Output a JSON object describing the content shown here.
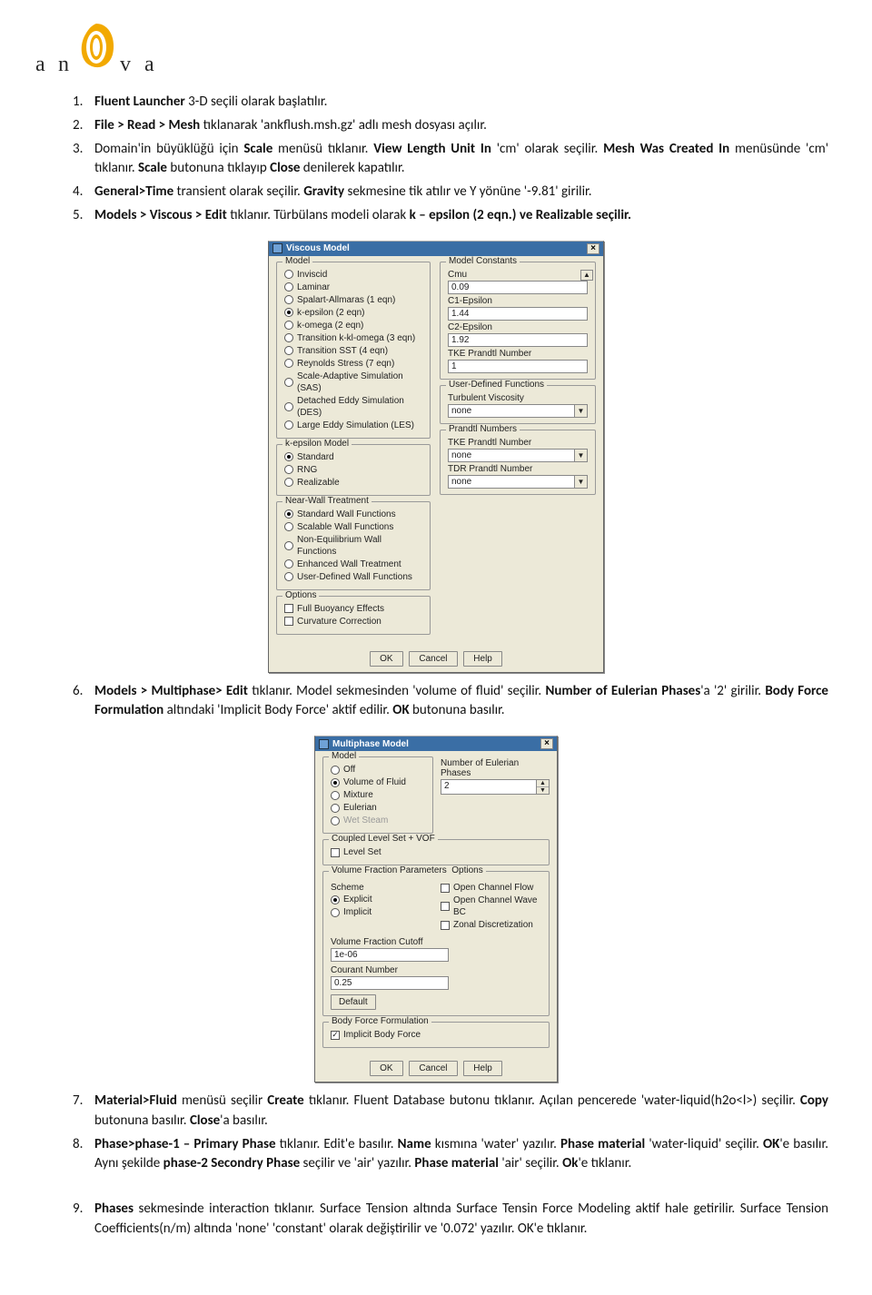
{
  "logo": {
    "letters": [
      "a",
      "n",
      "v",
      "a"
    ]
  },
  "steps": {
    "s1": {
      "pre": "",
      "b1": "Fluent Launcher",
      "mid1": " 3-D seçili olarak başlatılır."
    },
    "s2": {
      "b1": "File > Read > Mesh",
      "t1": " tıklanarak 'ankflush.msh.gz' adlı mesh dosyası açılır."
    },
    "s3": {
      "t1": "Domain'in büyüklüğü için ",
      "b1": "Scale",
      "t2": " menüsü tıklanır. ",
      "b2": "View Length Unit In",
      "t3": " 'cm' olarak seçilir. ",
      "b3": "Mesh Was Created In",
      "t4": " menüsünde 'cm' tıklanır. ",
      "b4": "Scale",
      "t5": " butonuna tıklayıp ",
      "b5": "Close",
      "t6": " denilerek kapatılır."
    },
    "s4": {
      "b1": "General>Time",
      "t1": " transient olarak seçilir.",
      "b2": " Gravity",
      "t2": " sekmesine tik atılır ve Y yönüne '-9.81' girilir."
    },
    "s5": {
      "b1": "Models > Viscous > Edit",
      "t1": " tıklanır. Türbülans modeli olarak ",
      "b2": "k – epsilon (2 eqn.) ve Realizable seçilir."
    },
    "s6": {
      "b1": "Models > Multiphase> Edit",
      "t1": " tıklanır. Model sekmesinden 'volume of fluid' seçilir. ",
      "b2": "Number of Eulerian Phases",
      "t2": "'a '2' girilir. ",
      "b3": "Body Force Formulation",
      "t3": " altındaki 'Implicit Body Force' aktif edilir. ",
      "b4": "OK",
      "t4": " butonuna basılır."
    },
    "s7": {
      "b1": "Material>Fluid",
      "t1": " menüsü seçilir ",
      "b2": "Create",
      "t2": " tıklanır. Fluent Database butonu tıklanır. Açılan pencerede 'water-liquid(h2o<l>) seçilir. ",
      "b3": "Copy",
      "t3": " butonuna basılır. ",
      "b4": "Close",
      "t4": "'a basılır."
    },
    "s8": {
      "b1": "Phase>phase-1 – Primary Phase",
      "t1": " tıklanır. Edit'e basılır. ",
      "b2": "Name",
      "t2": " kısmına 'water' yazılır. ",
      "b3": "Phase material",
      "t3": " 'water-liquid' seçilir. ",
      "b4": "OK",
      "t4": "'e basılır. Aynı şekilde ",
      "b5": "phase-2 Secondry Phase",
      "t5": " seçilir ve 'air' yazılır. ",
      "b6": "Phase material",
      "t6": " 'air' seçilir. ",
      "b7": "Ok",
      "t7": "'e tıklanır."
    },
    "s9": {
      "b1": "Phases",
      "t1": " sekmesinde interaction tıklanır. Surface Tension altında Surface Tensin Force Modeling aktif hale getirilir. Surface Tension Coefficients(n/m) altında 'none' 'constant' olarak değiştirilir ve '0.072' yazılır. OK'e tıklanır."
    }
  },
  "viscous": {
    "title": "Viscous Model",
    "g_model": "Model",
    "models": [
      "Inviscid",
      "Laminar",
      "Spalart-Allmaras (1 eqn)",
      "k-epsilon (2 eqn)",
      "k-omega (2 eqn)",
      "Transition k-kl-omega (3 eqn)",
      "Transition SST (4 eqn)",
      "Reynolds Stress (7 eqn)",
      "Scale-Adaptive Simulation (SAS)",
      "Detached Eddy Simulation (DES)",
      "Large Eddy Simulation (LES)"
    ],
    "selected_model_index": 3,
    "g_ke": "k-epsilon Model",
    "ke": [
      "Standard",
      "RNG",
      "Realizable"
    ],
    "ke_selected": 0,
    "g_wall": "Near-Wall Treatment",
    "walls": [
      "Standard Wall Functions",
      "Scalable Wall Functions",
      "Non-Equilibrium Wall Functions",
      "Enhanced Wall Treatment",
      "User-Defined Wall Functions"
    ],
    "wall_selected": 0,
    "g_opt": "Options",
    "opts": [
      "Full Buoyancy Effects",
      "Curvature Correction"
    ],
    "g_const": "Model Constants",
    "consts": [
      {
        "label": "Cmu",
        "val": "0.09"
      },
      {
        "label": "C1-Epsilon",
        "val": "1.44"
      },
      {
        "label": "C2-Epsilon",
        "val": "1.92"
      },
      {
        "label": "TKE Prandtl Number",
        "val": "1"
      }
    ],
    "g_udf": "User-Defined Functions",
    "udf": [
      {
        "label": "Turbulent Viscosity",
        "val": "none"
      }
    ],
    "g_pn": "Prandtl Numbers",
    "pn": [
      {
        "label": "TKE Prandtl Number",
        "val": "none"
      },
      {
        "label": "TDR Prandtl Number",
        "val": "none"
      }
    ],
    "btns": [
      "OK",
      "Cancel",
      "Help"
    ]
  },
  "multiphase": {
    "title": "Multiphase Model",
    "g_model": "Model",
    "models": [
      "Off",
      "Volume of Fluid",
      "Mixture",
      "Eulerian",
      "Wet Steam"
    ],
    "selected": 1,
    "nep_label": "Number of Eulerian Phases",
    "nep": "2",
    "g_cls": "Coupled Level Set + VOF",
    "cls": "Level Set",
    "g_vfp": "Volume Fraction Parameters",
    "g_vfp_opt": "Options",
    "scheme_label": "Scheme",
    "schemes": [
      "Explicit",
      "Implicit"
    ],
    "scheme_selected": 0,
    "vfp_opts": [
      "Open Channel Flow",
      "Open Channel Wave BC",
      "Zonal Discretization"
    ],
    "vfc_label": "Volume Fraction Cutoff",
    "vfc": "1e-06",
    "cn_label": "Courant Number",
    "cn": "0.25",
    "default_btn": "Default",
    "g_bff": "Body Force Formulation",
    "bff": "Implicit Body Force",
    "btns": [
      "OK",
      "Cancel",
      "Help"
    ]
  }
}
